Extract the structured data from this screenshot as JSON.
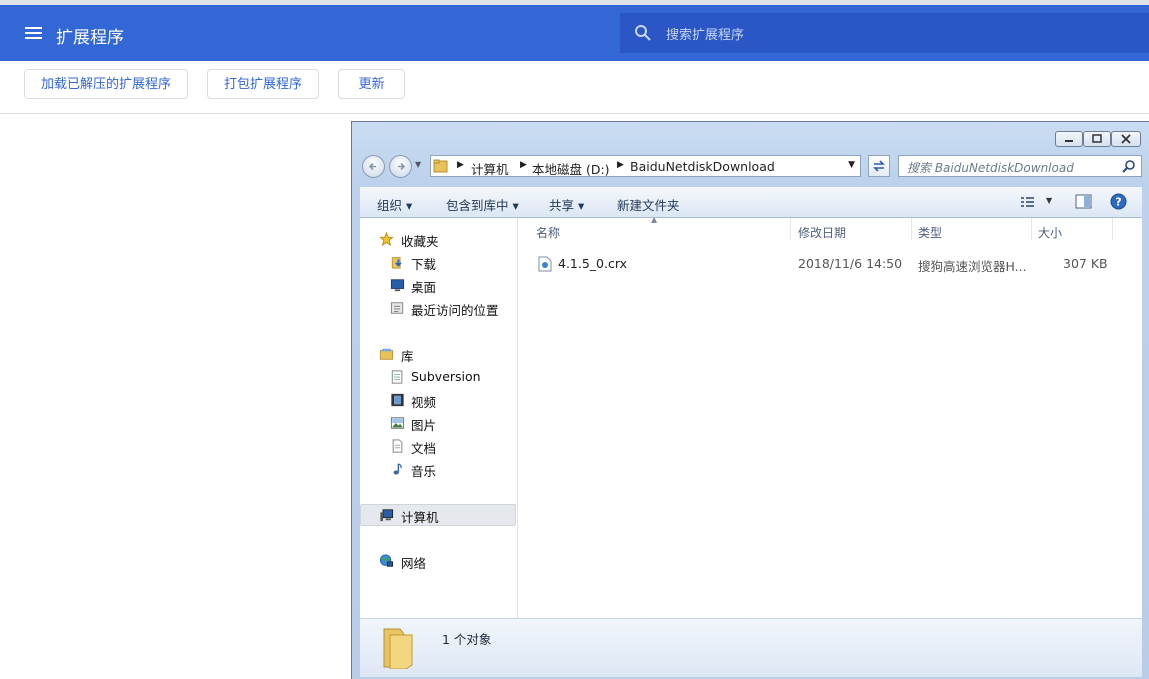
{
  "chrome": {
    "title": "扩展程序",
    "search_placeholder": "搜索扩展程序",
    "buttons": {
      "load_unpacked": "加载已解压的扩展程序",
      "pack": "打包扩展程序",
      "update": "更新"
    },
    "accent": "#3367d6"
  },
  "explorer": {
    "breadcrumb": [
      "计算机",
      "本地磁盘 (D:)",
      "BaiduNetdiskDownload"
    ],
    "search_placeholder": "搜索 BaiduNetdiskDownload",
    "commands": {
      "organize": "组织 ▾",
      "include_library": "包含到库中 ▾",
      "share": "共享 ▾",
      "new_folder": "新建文件夹"
    },
    "nav": {
      "favorites": "收藏夹",
      "downloads": "下载",
      "desktop": "桌面",
      "recent": "最近访问的位置",
      "libraries": "库",
      "subversion": "Subversion",
      "videos": "视频",
      "pictures": "图片",
      "documents": "文档",
      "music": "音乐",
      "computer": "计算机",
      "network": "网络"
    },
    "columns": {
      "name": "名称",
      "modified": "修改日期",
      "type": "类型",
      "size": "大小"
    },
    "files": [
      {
        "name": "4.1.5_0.crx",
        "modified": "2018/11/6 14:50",
        "type": "搜狗高速浏览器H...",
        "size": "307 KB"
      }
    ],
    "status": "1 个对象"
  }
}
